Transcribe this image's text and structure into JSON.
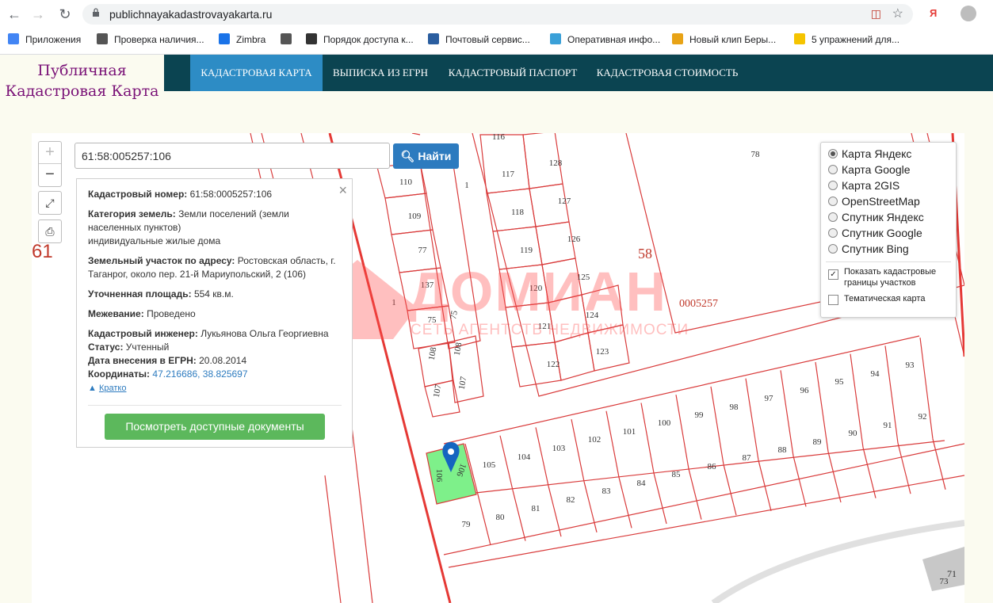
{
  "browser": {
    "url": "publichnayakadastrovayakarta.ru",
    "bookmarks": [
      {
        "label": "Приложения",
        "icon": "apps-grid-icon",
        "color": "#4285f4"
      },
      {
        "label": "Проверка наличия...",
        "icon": "globe-icon",
        "color": "#555555"
      },
      {
        "label": "Zimbra",
        "icon": "zimbra-icon",
        "color": "#1a73e8"
      },
      {
        "label": "",
        "icon": "globe-icon",
        "color": "#555555"
      },
      {
        "label": "Порядок доступа к...",
        "icon": "nsk-icon",
        "color": "#333333"
      },
      {
        "label": "Почтовый сервис...",
        "icon": "mail-service-icon",
        "color": "#2a5d9f"
      },
      {
        "label": "Оперативная инфо...",
        "icon": "drop-icon",
        "color": "#3aa0d8"
      },
      {
        "label": "Новый клип Беры...",
        "icon": "clip-icon",
        "color": "#e8a316"
      },
      {
        "label": "5 упражнений для...",
        "icon": "ad-icon",
        "color": "#f5c400"
      }
    ]
  },
  "site": {
    "logo_line1": "Публичная",
    "logo_line2": "Кадастровая Карта",
    "nav": [
      "КАДАСТРОВАЯ КАРТА",
      "ВЫПИСКА ИЗ ЕГРН",
      "КАДАСТРОВЫЙ ПАСПОРТ",
      "КАДАСТРОВАЯ СТОИМОСТЬ"
    ]
  },
  "map": {
    "region_code": "61",
    "search_value": "61:58:005257:106",
    "search_button": "Найти",
    "zoom_in": "+",
    "zoom_out": "−",
    "quarter_number": "58",
    "block_number": "0005257",
    "watermark_title": "ДОМИАН",
    "watermark_subtitle": "СЕТЬ АГЕНТСТВ НЕДВИЖИМОСТИ",
    "parcels_top_left": [
      "116",
      "110",
      "1",
      "117",
      "128",
      "109",
      "118",
      "127",
      "77",
      "119",
      "126",
      "137",
      "120",
      "125",
      "75",
      "124",
      "121",
      "108",
      "108",
      "123",
      "122",
      "107",
      "107",
      "1",
      "75"
    ],
    "parcels_row_upper": [
      "105",
      "104",
      "103",
      "102",
      "101",
      "100",
      "99",
      "98",
      "97",
      "96",
      "95",
      "94",
      "93"
    ],
    "parcels_row_lower": [
      "80",
      "81",
      "82",
      "83",
      "84",
      "85",
      "86",
      "87",
      "88",
      "89",
      "90",
      "91",
      "92"
    ],
    "parcel_selected": [
      "106",
      "106"
    ],
    "parcel_79": "79",
    "parcel_78": "78",
    "parcels_corner": [
      "71",
      "73"
    ]
  },
  "info": {
    "cad_label": "Кадастровый номер:",
    "cad_value": "61:58:0005257:106",
    "cat_label": "Категория земель:",
    "cat_value": "Земли поселений (земли населенных пунктов)",
    "cat_use": "индивидуальные жилые дома",
    "addr_label": "Земельный участок по адресу:",
    "addr_value": "Ростовская область, г. Таганрог, около пер. 21-й Мариупольский, 2 (106)",
    "area_label": "Уточненная площадь:",
    "area_value": "554 кв.м.",
    "survey_label": "Межевание:",
    "survey_value": "Проведено",
    "engineer_label": "Кадастровый инженер:",
    "engineer_value": "Лукьянова Ольга Георгиевна",
    "status_label": "Статус:",
    "status_value": "Учтенный",
    "date_label": "Дата внесения в ЕГРН:",
    "date_value": "20.08.2014",
    "coords_label": "Координаты:",
    "coords_value": "47.216686, 38.825697",
    "brief_link": "Кратко",
    "docs_button": "Посмотреть доступные документы"
  },
  "layers": {
    "options": [
      "Карта Яндекс",
      "Карта Google",
      "Карта 2GIS",
      "OpenStreetMap",
      "Спутник Яндекс",
      "Спутник Google",
      "Спутник Bing"
    ],
    "selected_index": 0,
    "show_borders": "Показать кадастровые границы участков",
    "show_borders_checked": true,
    "thematic": "Тематическая карта",
    "thematic_checked": false
  }
}
